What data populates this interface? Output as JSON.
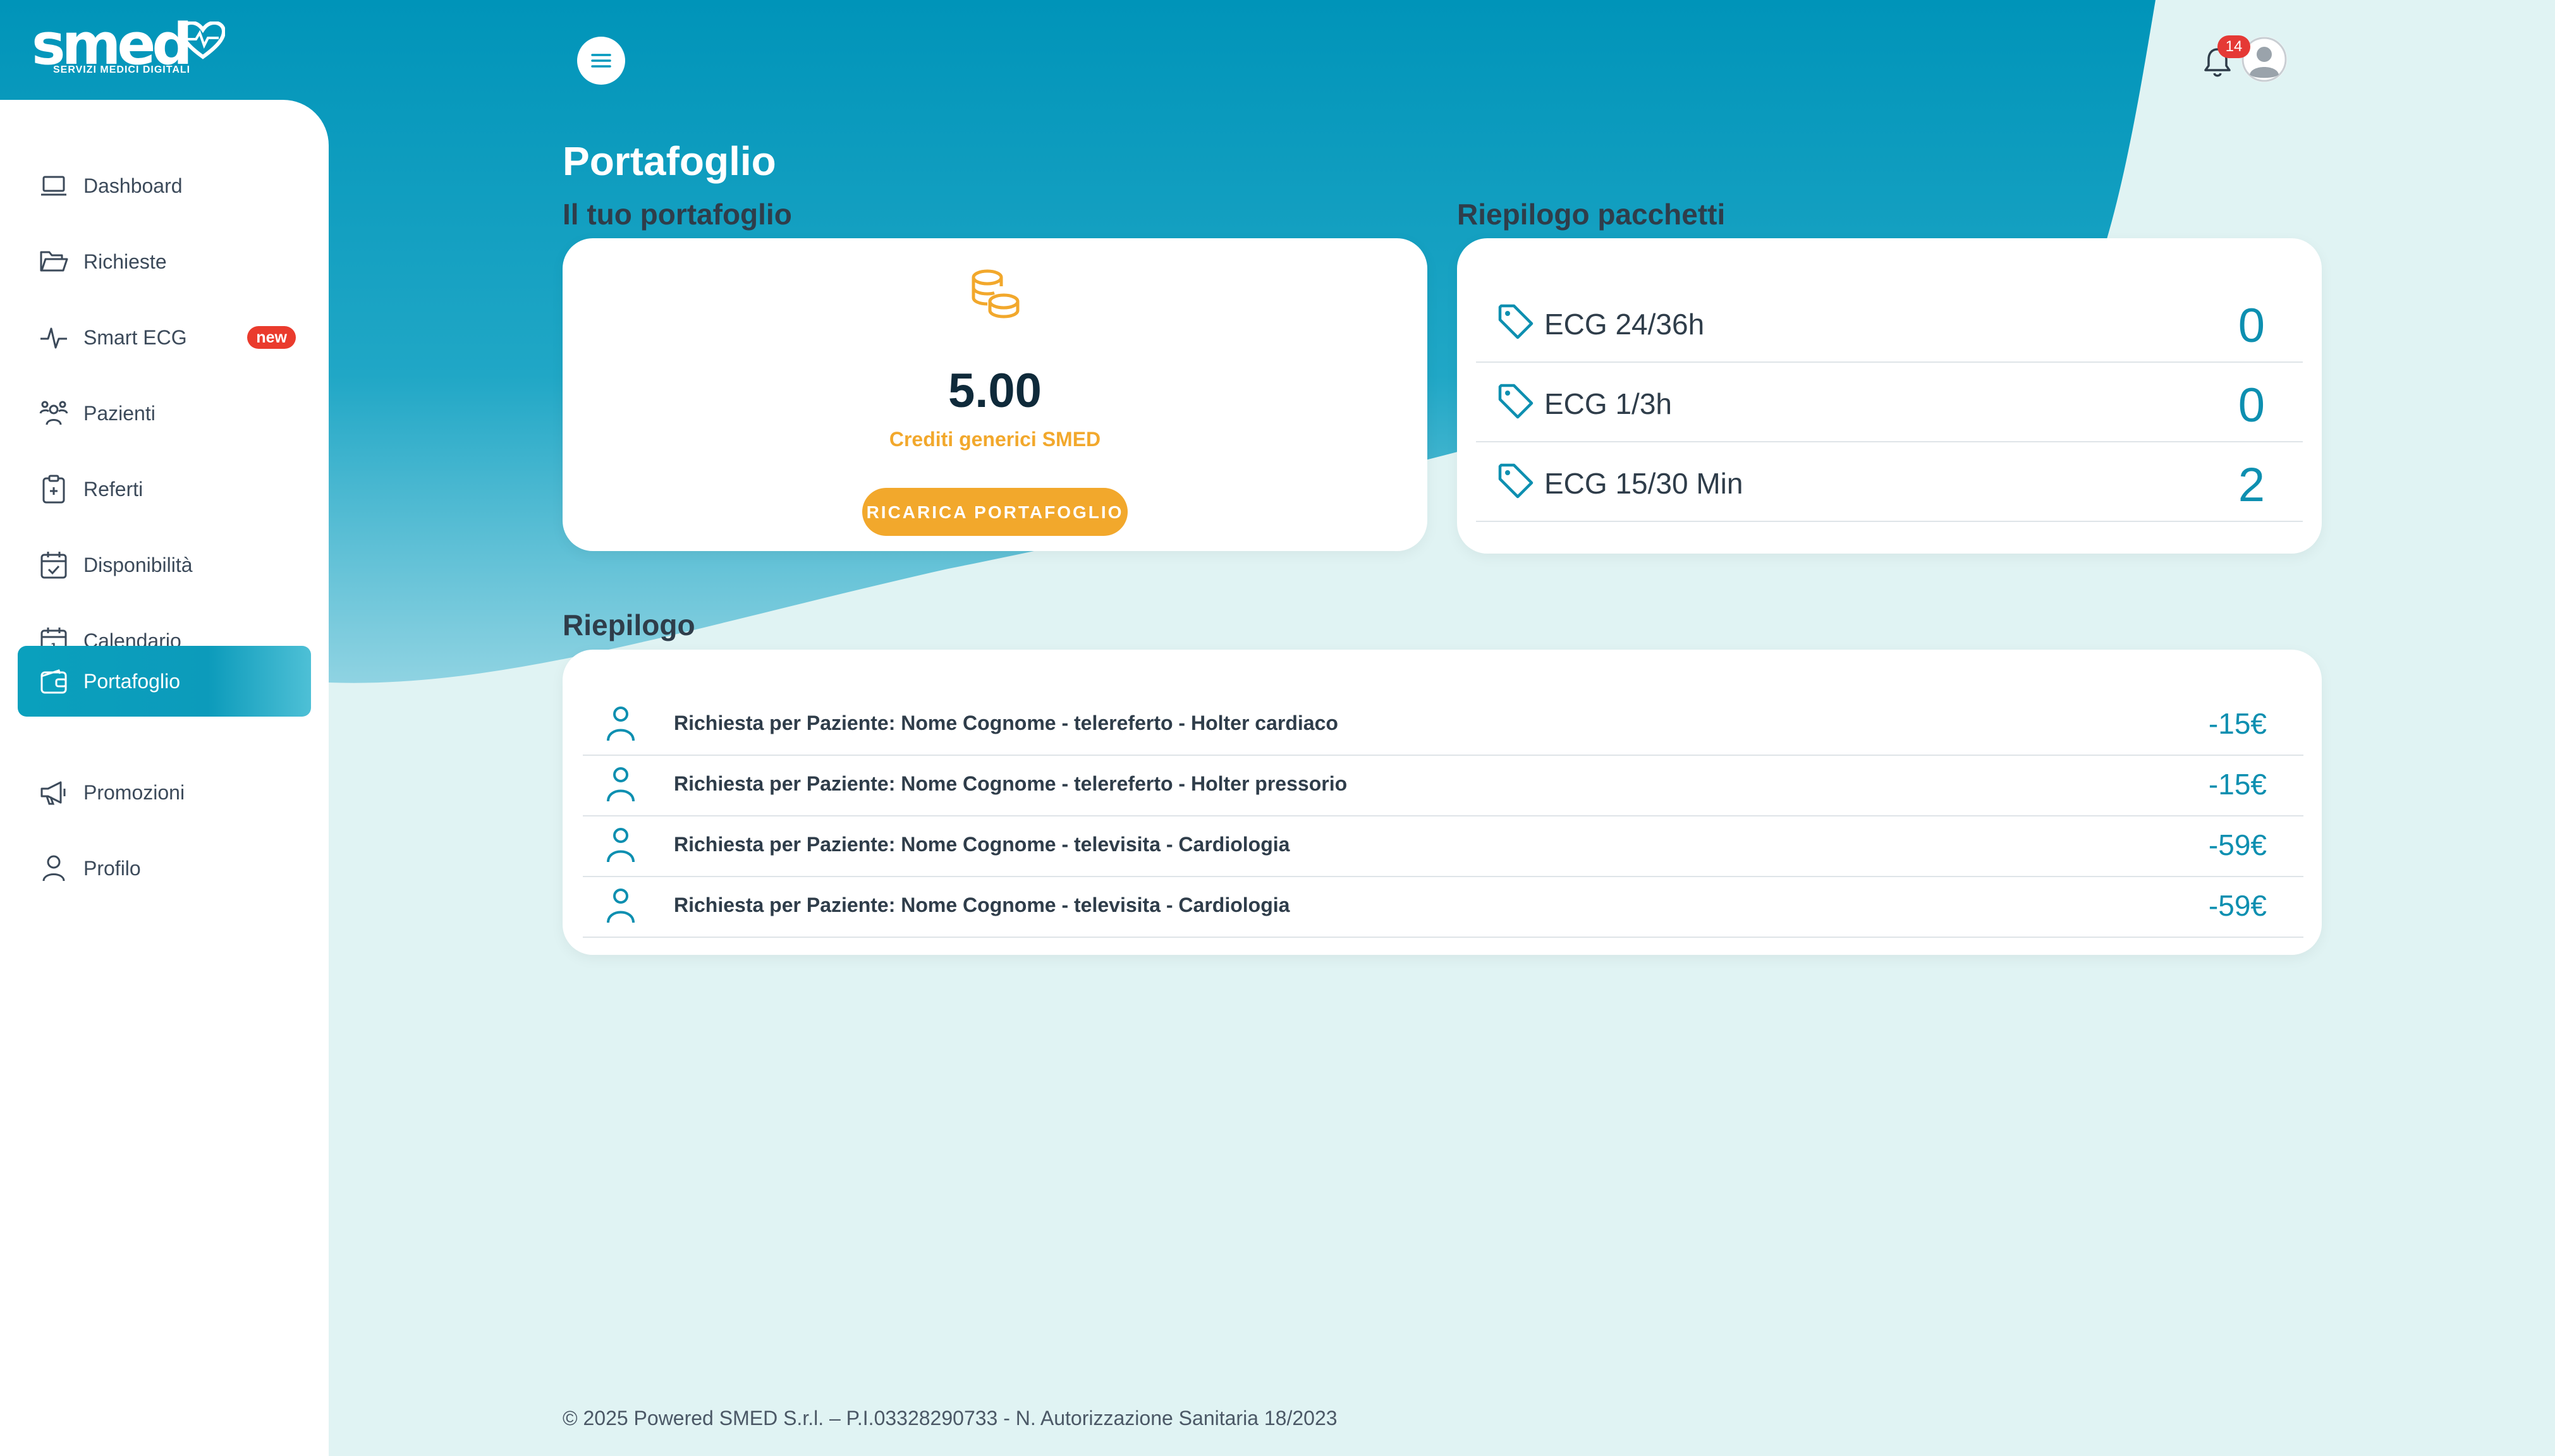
{
  "brand": {
    "name": "smed",
    "tagline": "SERVIZI MEDICI DIGITALI"
  },
  "sidebar": {
    "items": [
      {
        "label": "Dashboard",
        "icon": "laptop-icon"
      },
      {
        "label": "Richieste",
        "icon": "folder-open-icon"
      },
      {
        "label": "Smart ECG",
        "icon": "heartbeat-icon",
        "badge": "new"
      },
      {
        "label": "Pazienti",
        "icon": "users-icon"
      },
      {
        "label": "Referti",
        "icon": "clipboard-plus-icon"
      },
      {
        "label": "Disponibilità",
        "icon": "calendar-check-icon"
      },
      {
        "label": "Calendario",
        "icon": "calendar-icon"
      },
      {
        "label": "Portafoglio",
        "icon": "wallet-icon",
        "active": true
      },
      {
        "label": "Promozioni",
        "icon": "megaphone-icon"
      },
      {
        "label": "Profilo",
        "icon": "user-icon"
      }
    ]
  },
  "topbar": {
    "notifications_count": "14",
    "menu_icon": "hamburger-icon",
    "bell_icon": "bell-icon",
    "avatar_icon": "avatar-icon"
  },
  "page": {
    "title": "Portafoglio"
  },
  "wallet": {
    "heading": "Il tuo portafoglio",
    "amount": "5.00",
    "credits_label": "Crediti generici SMED",
    "recharge_button": "RICARICA PORTAFOGLIO",
    "icon": "coins-icon"
  },
  "packages": {
    "heading": "Riepilogo pacchetti",
    "items": [
      {
        "name": "ECG 24/36h",
        "count": "0"
      },
      {
        "name": "ECG 1/3h",
        "count": "0"
      },
      {
        "name": "ECG 15/30 Min",
        "count": "2"
      }
    ]
  },
  "summary": {
    "heading": "Riepilogo",
    "items": [
      {
        "description": "Richiesta per Paziente: Nome Cognome - telereferto - Holter cardiaco",
        "amount": "-15€"
      },
      {
        "description": "Richiesta per Paziente: Nome Cognome - telereferto - Holter pressorio",
        "amount": "-15€"
      },
      {
        "description": "Richiesta per Paziente: Nome Cognome - televisita - Cardiologia",
        "amount": "-59€"
      },
      {
        "description": "Richiesta per Paziente: Nome Cognome - televisita - Cardiologia",
        "amount": "-59€"
      }
    ]
  },
  "footer": {
    "text": "© 2025 Powered SMED S.r.l. – P.I.03328290733 - N. Autorizzazione Sanitaria 18/2023"
  },
  "colors": {
    "primary": "#0099bd",
    "accent": "#f2a82c",
    "background": "#e0f3f3",
    "badge": "#e53935"
  }
}
